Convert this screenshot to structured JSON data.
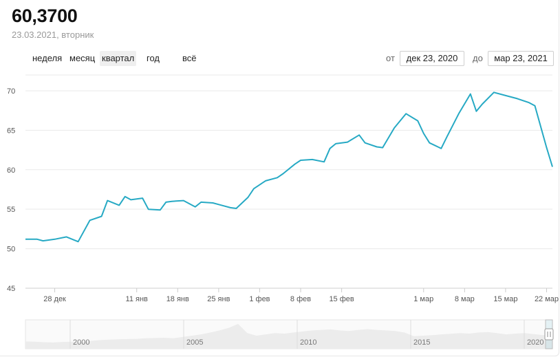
{
  "header": {
    "price": "60,3700",
    "date": "23.03.2021",
    "weekday": ", вторник"
  },
  "periods": [
    {
      "label": "неделя",
      "active": false
    },
    {
      "label": "месяц",
      "active": false
    },
    {
      "label": "квартал",
      "active": true
    },
    {
      "label": "год",
      "active": false
    },
    {
      "label": "всё",
      "active": false
    }
  ],
  "range": {
    "from_label": "от",
    "from_value": "дек 23, 2020",
    "to_label": "до",
    "to_value": "мар 23, 2021"
  },
  "colors": {
    "line": "#26a9c4",
    "grid": "#e9e9e9",
    "navigator_fill": "#ececec",
    "active_period_bg": "#efefef"
  },
  "chart_data": {
    "type": "line",
    "ylim": [
      45,
      72
    ],
    "yticks": [
      45,
      50,
      55,
      60,
      65,
      70
    ],
    "grid": true,
    "x_start": "2020-12-23",
    "x_end": "2021-03-23",
    "xtick_labels": [
      {
        "date": "2020-12-28",
        "label": "28 дек"
      },
      {
        "date": "2021-01-11",
        "label": "11 янв"
      },
      {
        "date": "2021-01-18",
        "label": "18 янв"
      },
      {
        "date": "2021-01-25",
        "label": "25 янв"
      },
      {
        "date": "2021-02-01",
        "label": "1 фев"
      },
      {
        "date": "2021-02-08",
        "label": "8 фев"
      },
      {
        "date": "2021-02-15",
        "label": "15 фев"
      },
      {
        "date": "2021-03-01",
        "label": "1 мар"
      },
      {
        "date": "2021-03-08",
        "label": "8 мар"
      },
      {
        "date": "2021-03-15",
        "label": "15 мар"
      },
      {
        "date": "2021-03-22",
        "label": "22 мар"
      }
    ],
    "series": [
      {
        "x": [
          "2020-12-23",
          "2020-12-24",
          "2020-12-25",
          "2020-12-26",
          "2020-12-28",
          "2020-12-30",
          "2021-01-01",
          "2021-01-03",
          "2021-01-05",
          "2021-01-06",
          "2021-01-08",
          "2021-01-09",
          "2021-01-10",
          "2021-01-12",
          "2021-01-13",
          "2021-01-15",
          "2021-01-16",
          "2021-01-17",
          "2021-01-19",
          "2021-01-21",
          "2021-01-22",
          "2021-01-24",
          "2021-01-25",
          "2021-01-27",
          "2021-01-28",
          "2021-01-30",
          "2021-01-31",
          "2021-02-02",
          "2021-02-04",
          "2021-02-05",
          "2021-02-07",
          "2021-02-08",
          "2021-02-10",
          "2021-02-12",
          "2021-02-13",
          "2021-02-14",
          "2021-02-16",
          "2021-02-18",
          "2021-02-19",
          "2021-02-21",
          "2021-02-22",
          "2021-02-24",
          "2021-02-26",
          "2021-02-28",
          "2021-03-01",
          "2021-03-02",
          "2021-03-04",
          "2021-03-05",
          "2021-03-07",
          "2021-03-09",
          "2021-03-10",
          "2021-03-11",
          "2021-03-13",
          "2021-03-15",
          "2021-03-17",
          "2021-03-19",
          "2021-03-20",
          "2021-03-22",
          "2021-03-23"
        ],
        "values": [
          51.2,
          51.2,
          51.2,
          51.0,
          51.2,
          51.5,
          50.9,
          53.6,
          54.1,
          56.1,
          55.5,
          56.6,
          56.2,
          56.4,
          55.0,
          54.9,
          55.9,
          56.0,
          56.1,
          55.3,
          55.9,
          55.8,
          55.6,
          55.2,
          55.1,
          56.5,
          57.6,
          58.6,
          59.0,
          59.5,
          60.7,
          61.2,
          61.3,
          61.0,
          62.7,
          63.3,
          63.5,
          64.4,
          63.4,
          62.9,
          62.8,
          65.3,
          67.1,
          66.2,
          64.6,
          63.4,
          62.7,
          64.2,
          67.1,
          69.6,
          67.4,
          68.3,
          69.8,
          69.4,
          69.0,
          68.5,
          68.1,
          62.8,
          60.37
        ]
      }
    ]
  },
  "navigator": {
    "years": [
      "2000",
      "2005",
      "2010",
      "2015",
      "2020"
    ]
  }
}
